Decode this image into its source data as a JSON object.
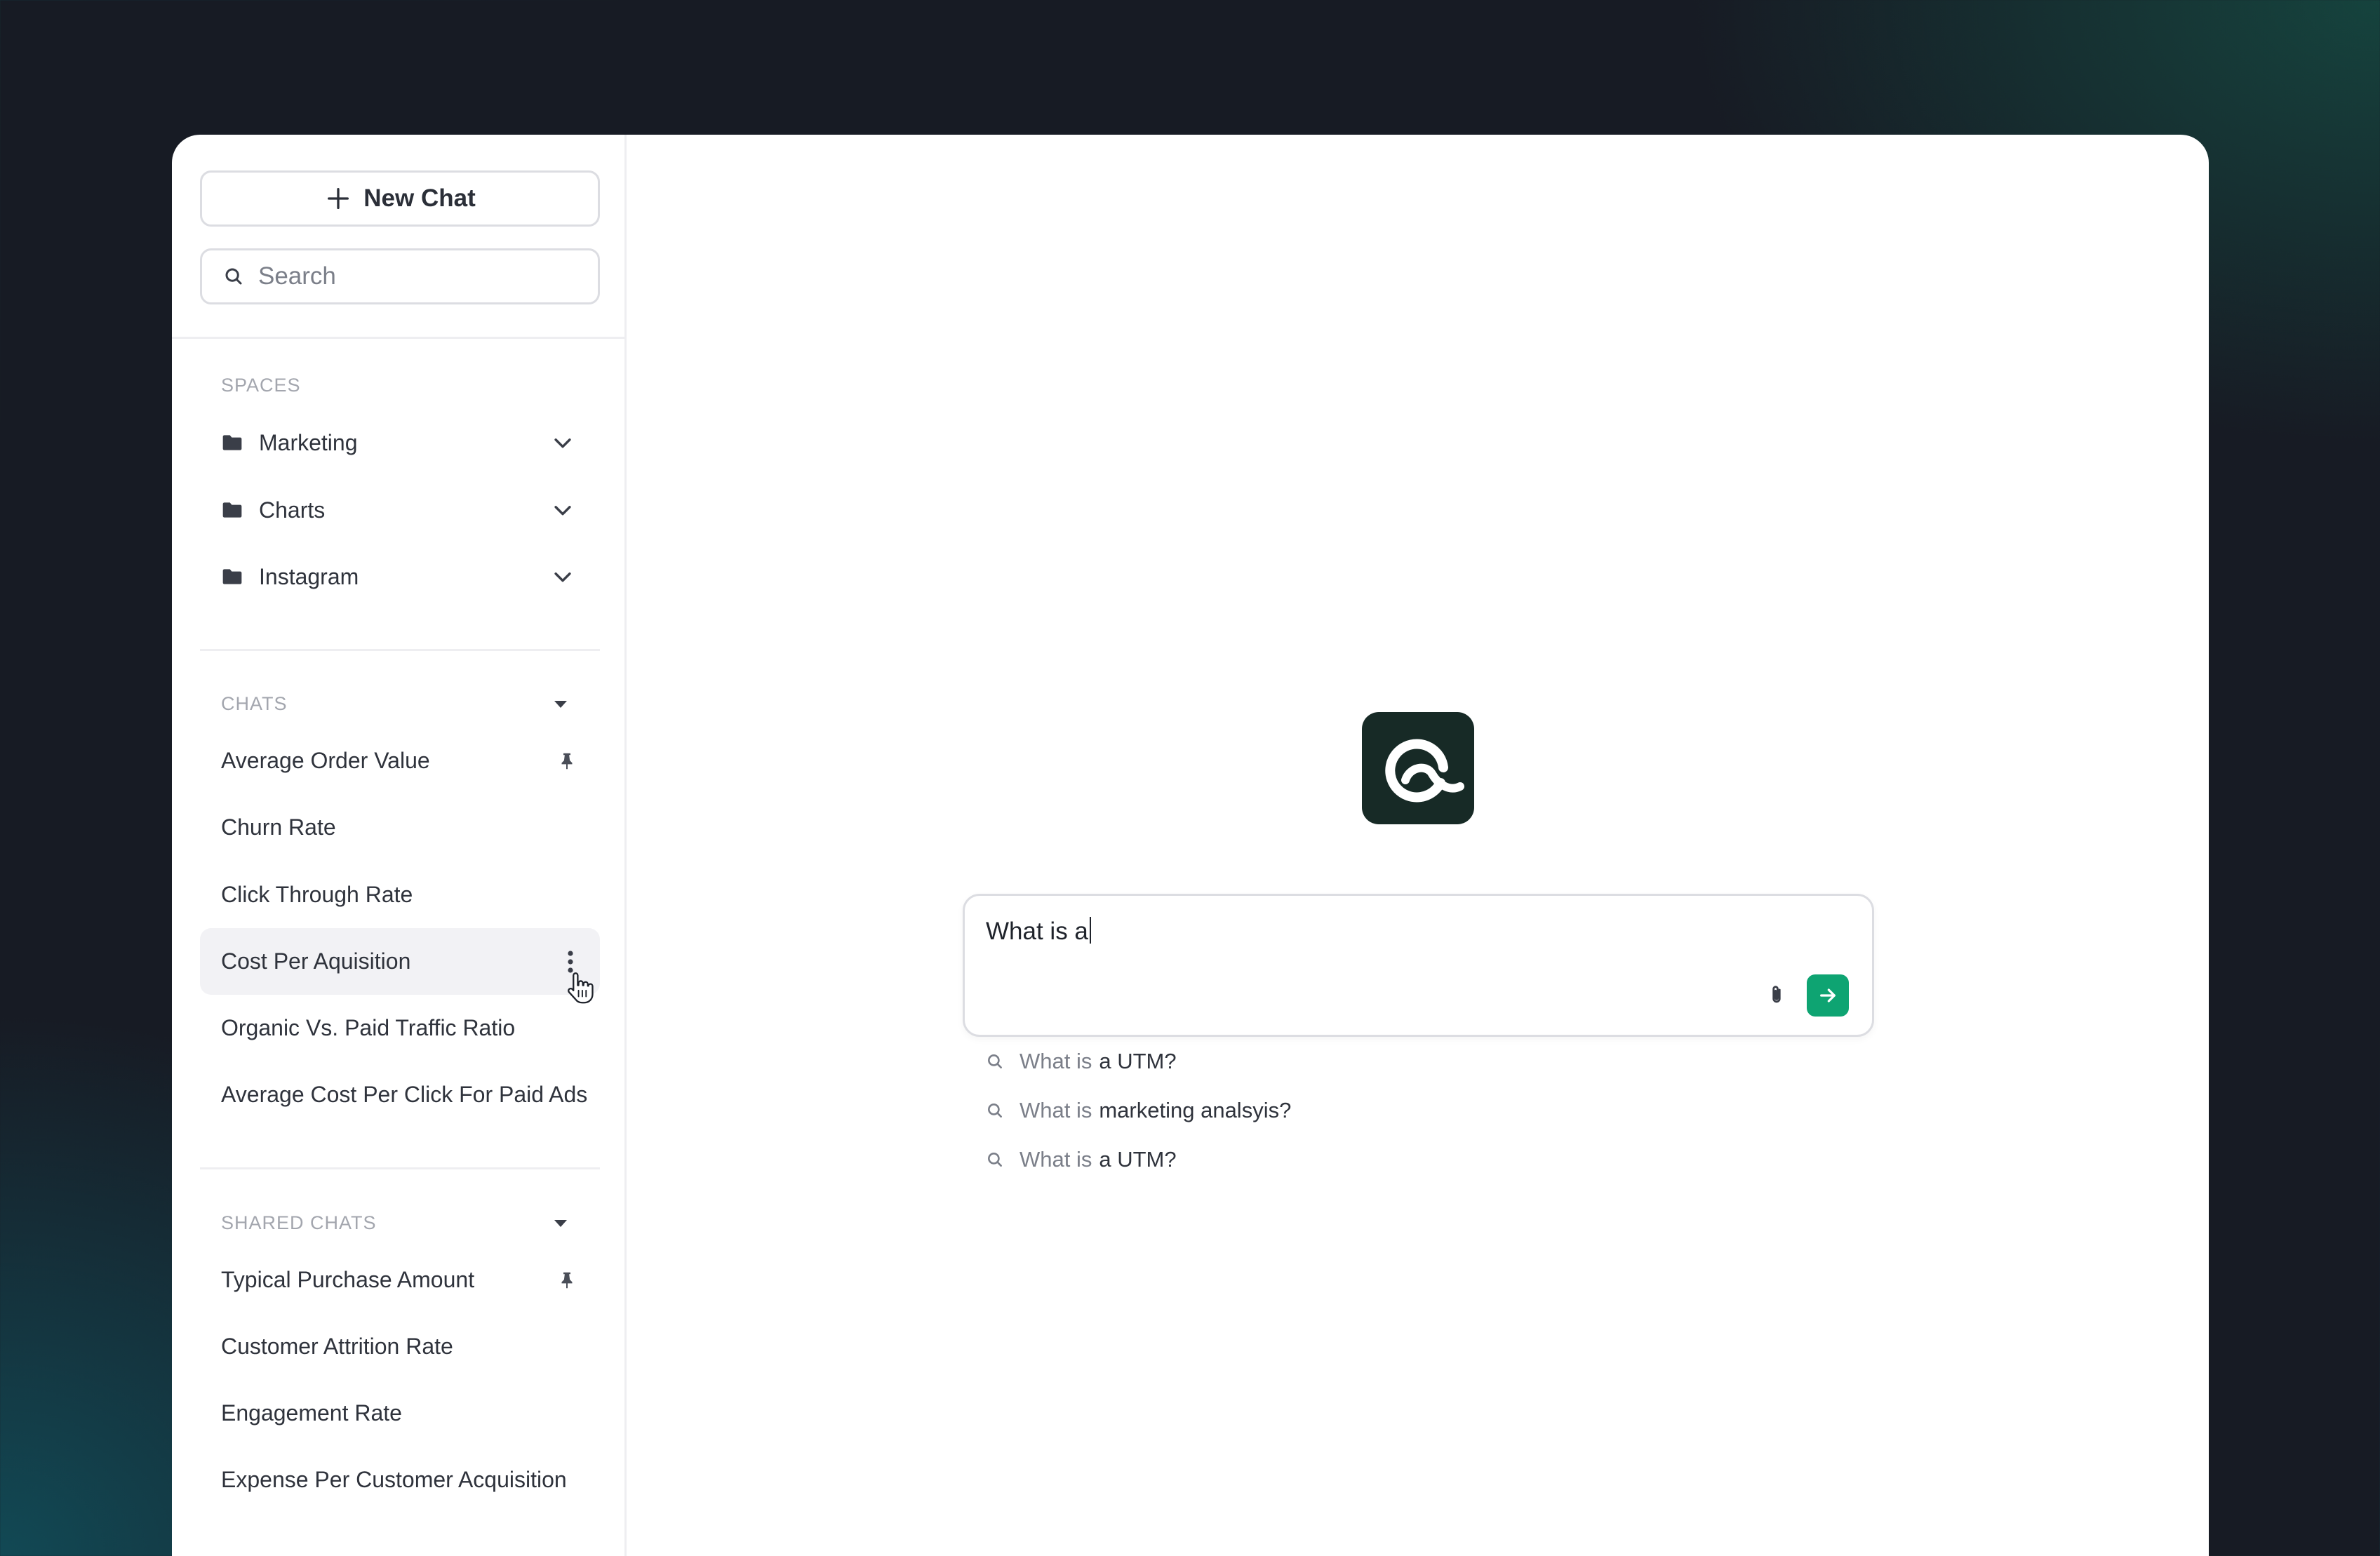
{
  "sidebar": {
    "new_chat_label": "New Chat",
    "search_placeholder": "Search",
    "spaces": {
      "heading": "SPACES",
      "items": [
        {
          "label": "Marketing"
        },
        {
          "label": "Charts"
        },
        {
          "label": "Instagram"
        }
      ]
    },
    "chats": {
      "heading": "CHATS",
      "items": [
        {
          "label": "Average Order Value",
          "pinned": true
        },
        {
          "label": "Churn Rate"
        },
        {
          "label": "Click Through Rate"
        },
        {
          "label": "Cost Per Aquisition",
          "active": true
        },
        {
          "label": "Organic Vs. Paid Traffic Ratio"
        },
        {
          "label": "Average Cost Per Click For Paid Ads"
        }
      ]
    },
    "shared_chats": {
      "heading": "SHARED CHATS",
      "items": [
        {
          "label": "Typical Purchase Amount",
          "pinned": true
        },
        {
          "label": "Customer Attrition Rate"
        },
        {
          "label": "Engagement Rate"
        },
        {
          "label": "Expense Per Customer Acquisition"
        }
      ]
    }
  },
  "main": {
    "input_value": "What is a",
    "suggestions": [
      {
        "prefix": "What is",
        "rest": "a UTM?"
      },
      {
        "prefix": "What is",
        "rest": "marketing analsyis?"
      },
      {
        "prefix": "What is",
        "rest": "a UTM?"
      }
    ]
  },
  "colors": {
    "accent": "#0ea472",
    "logo_bg": "#172a26",
    "active_row": "#f2f2f5"
  }
}
